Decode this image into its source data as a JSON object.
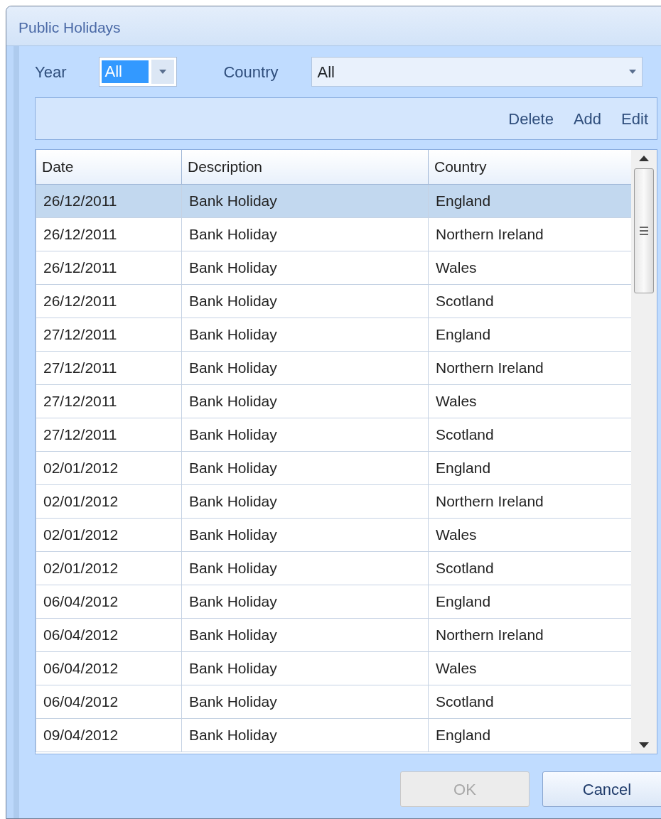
{
  "window": {
    "title": "Public Holidays"
  },
  "filters": {
    "year": {
      "label": "Year",
      "value": "All",
      "text_selected": true
    },
    "country": {
      "label": "Country",
      "value": "All"
    }
  },
  "toolbar": {
    "actions": [
      "Delete",
      "Add",
      "Edit"
    ]
  },
  "table": {
    "columns": [
      "Date",
      "Description",
      "Country"
    ],
    "rows": [
      {
        "date": "26/12/2011",
        "description": "Bank Holiday",
        "country": "England",
        "selected": true
      },
      {
        "date": "26/12/2011",
        "description": "Bank Holiday",
        "country": "Northern Ireland",
        "selected": false
      },
      {
        "date": "26/12/2011",
        "description": "Bank Holiday",
        "country": "Wales",
        "selected": false
      },
      {
        "date": "26/12/2011",
        "description": "Bank Holiday",
        "country": "Scotland",
        "selected": false
      },
      {
        "date": "27/12/2011",
        "description": "Bank Holiday",
        "country": "England",
        "selected": false
      },
      {
        "date": "27/12/2011",
        "description": "Bank Holiday",
        "country": "Northern Ireland",
        "selected": false
      },
      {
        "date": "27/12/2011",
        "description": "Bank Holiday",
        "country": "Wales",
        "selected": false
      },
      {
        "date": "27/12/2011",
        "description": "Bank Holiday",
        "country": "Scotland",
        "selected": false
      },
      {
        "date": "02/01/2012",
        "description": "Bank Holiday",
        "country": "England",
        "selected": false
      },
      {
        "date": "02/01/2012",
        "description": "Bank Holiday",
        "country": "Northern Ireland",
        "selected": false
      },
      {
        "date": "02/01/2012",
        "description": "Bank Holiday",
        "country": "Wales",
        "selected": false
      },
      {
        "date": "02/01/2012",
        "description": "Bank Holiday",
        "country": "Scotland",
        "selected": false
      },
      {
        "date": "06/04/2012",
        "description": "Bank Holiday",
        "country": "England",
        "selected": false
      },
      {
        "date": "06/04/2012",
        "description": "Bank Holiday",
        "country": "Northern Ireland",
        "selected": false
      },
      {
        "date": "06/04/2012",
        "description": "Bank Holiday",
        "country": "Wales",
        "selected": false
      },
      {
        "date": "06/04/2012",
        "description": "Bank Holiday",
        "country": "Scotland",
        "selected": false
      },
      {
        "date": "09/04/2012",
        "description": "Bank Holiday",
        "country": "England",
        "selected": false
      }
    ]
  },
  "buttons": [
    {
      "label": "OK",
      "disabled": true
    },
    {
      "label": "Cancel",
      "disabled": false
    }
  ]
}
